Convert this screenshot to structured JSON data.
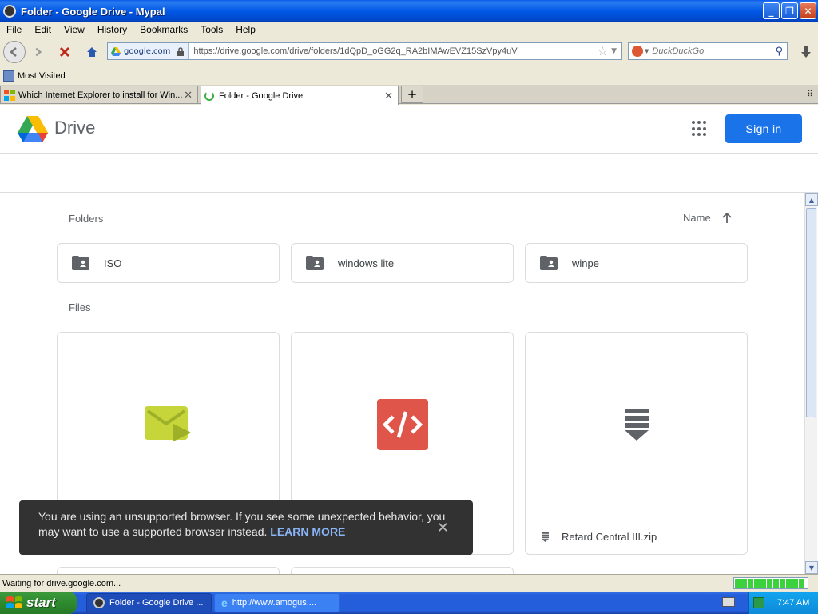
{
  "window": {
    "title": "Folder - Google Drive - Mypal"
  },
  "menu": [
    "File",
    "Edit",
    "View",
    "History",
    "Bookmarks",
    "Tools",
    "Help"
  ],
  "nav": {
    "site_identity": "google.com",
    "url": "https://drive.google.com/drive/folders/1dQpD_oGG2q_RA2bIMAwEVZ15SzVpy4uV",
    "search_placeholder": "DuckDuckGo"
  },
  "bookmarks": {
    "most_visited": "Most Visited"
  },
  "tabs": [
    {
      "label": "Which Internet Explorer to install for Win..."
    },
    {
      "label": "Folder - Google Drive"
    }
  ],
  "drive": {
    "brand": "Drive",
    "signin": "Sign in",
    "folders_label": "Folders",
    "sort_label": "Name",
    "files_label": "Files",
    "folders": [
      "ISO",
      "windows lite",
      "winpe"
    ],
    "files": [
      {
        "name": ""
      },
      {
        "name": ""
      },
      {
        "name": "Retard Central III.zip"
      }
    ]
  },
  "toast": {
    "message": "You are using an unsupported browser. If you see some unexpected behavior, you may want to use a supported browser instead.",
    "link": "LEARN MORE"
  },
  "status": {
    "text": "Waiting for drive.google.com...",
    "progress": 1.0
  },
  "taskbar": {
    "start": "start",
    "items": [
      "Folder - Google Drive ...",
      "http://www.amogus...."
    ],
    "clock": "7:47 AM"
  },
  "colors": {
    "accent": "#1a73e8",
    "titlebar": "#0058e6",
    "taskbar": "#245edb"
  }
}
